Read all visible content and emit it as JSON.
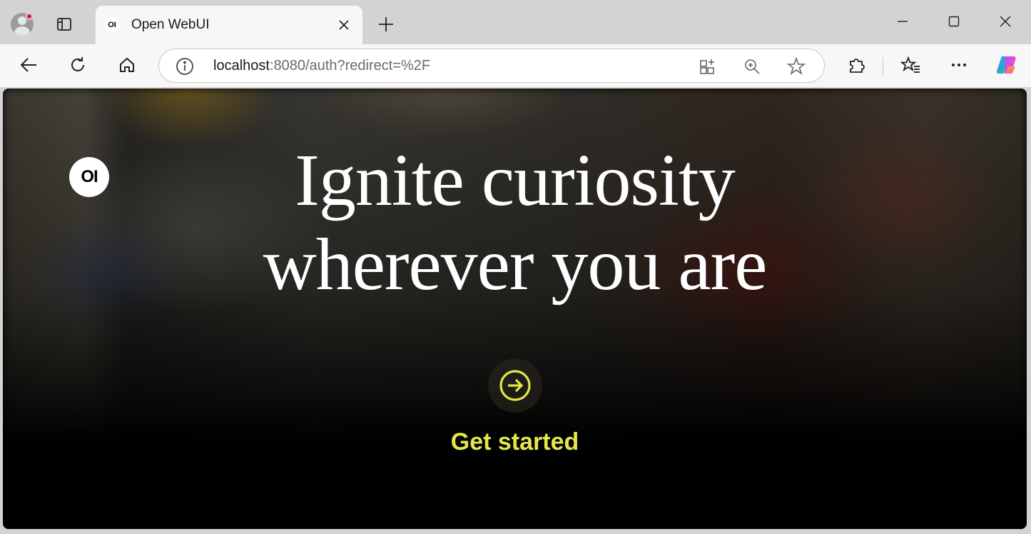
{
  "browser": {
    "tab": {
      "title": "Open WebUI",
      "favicon_text": "OI"
    },
    "address": {
      "host": "localhost",
      "rest": ":8080/auth?redirect=%2F"
    },
    "icons": {
      "profile": "profile-icon",
      "tab_actions": "tab-actions-icon",
      "close_tab": "close-icon",
      "new_tab": "plus-icon",
      "minimize": "minimize-icon",
      "maximize": "maximize-icon",
      "close_window": "close-window-icon",
      "back": "back-arrow-icon",
      "reload": "reload-icon",
      "home": "home-icon",
      "site_info": "info-icon",
      "app_available": "apps-icon",
      "zoom": "zoom-icon",
      "favorite": "star-icon",
      "extensions": "puzzle-icon",
      "favorites": "favorites-icon",
      "menu": "more-icon",
      "copilot": "copilot-icon"
    },
    "colors": {
      "notification_dot": "#e81123"
    }
  },
  "page": {
    "logo_text": "OI",
    "headline_line1": "Ignite curiosity",
    "headline_line2": "wherever you are",
    "cta_label": "Get started",
    "colors": {
      "accent": "#e6e54a"
    }
  }
}
